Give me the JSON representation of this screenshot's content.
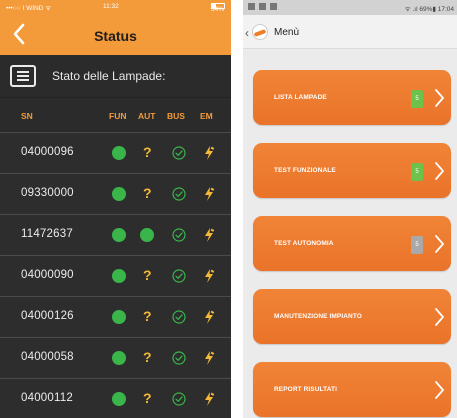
{
  "left_screen": {
    "status_bar": {
      "carrier": "•••○○ I WIND ᯤ",
      "time": "11:32",
      "battery": "34%"
    },
    "nav": {
      "title": "Status"
    },
    "header": {
      "label": "Stato delle Lampade:"
    },
    "columns": {
      "sn": "SN",
      "fun": "FUN",
      "aut": "AUT",
      "bus": "BUS",
      "em": "EM"
    },
    "rows": [
      {
        "sn": "04000096",
        "aut": "?"
      },
      {
        "sn": "09330000",
        "aut": "?"
      },
      {
        "sn": "11472637",
        "aut": "ok"
      },
      {
        "sn": "04000090",
        "aut": "?"
      },
      {
        "sn": "04000126",
        "aut": "?"
      },
      {
        "sn": "04000058",
        "aut": "?"
      },
      {
        "sn": "04000112",
        "aut": "?"
      }
    ],
    "question_mark": "?"
  },
  "right_screen": {
    "status_bar": {
      "right": "ᯤ .ıl 69%▮ 17:04"
    },
    "app_bar": {
      "title": "Menù"
    },
    "menu_items": [
      {
        "label": "LISTA LAMPADE",
        "badge": "5",
        "badge_color": "#6cc24a"
      },
      {
        "label": "TEST FUNZIONALE",
        "badge": "5",
        "badge_color": "#6cc24a"
      },
      {
        "label": "TEST AUTONOMIA",
        "badge": "5",
        "badge_color": "#a9a9a9"
      },
      {
        "label": "MANUTENZIONE IMPIANTO"
      },
      {
        "label": "REPORT RISULTATI"
      }
    ]
  },
  "colors": {
    "accent": "#f39a3a",
    "ok_green": "#39b54a",
    "warn_yellow": "#f5b935",
    "card_orange": "#ef7d2b"
  }
}
